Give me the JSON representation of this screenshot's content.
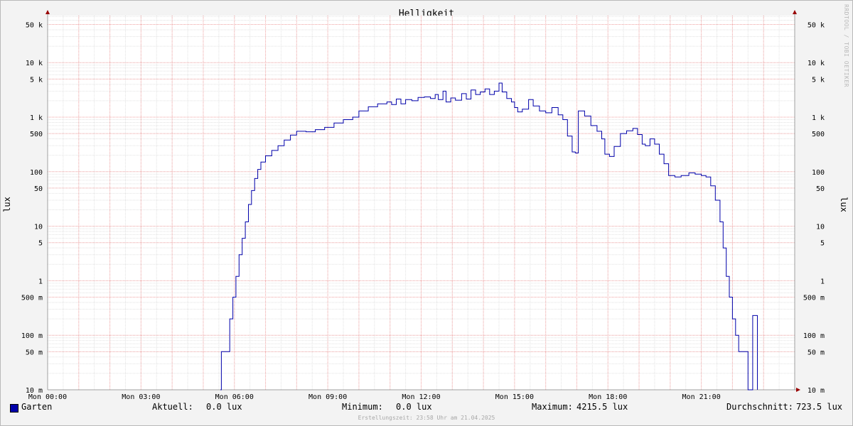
{
  "chart_data": {
    "type": "line",
    "title": "Helligkeit",
    "ylabel": "lux",
    "y_scale": "log",
    "ylim": [
      0.01,
      80000
    ],
    "grid": true,
    "y_ticks": [
      {
        "value": 50000,
        "label": "50 k"
      },
      {
        "value": 10000,
        "label": "10 k"
      },
      {
        "value": 5000,
        "label": "5 k"
      },
      {
        "value": 1000,
        "label": "1 k"
      },
      {
        "value": 500,
        "label": "500"
      },
      {
        "value": 100,
        "label": "100"
      },
      {
        "value": 50,
        "label": "50"
      },
      {
        "value": 10,
        "label": "10"
      },
      {
        "value": 5,
        "label": "5"
      },
      {
        "value": 1,
        "label": "1"
      },
      {
        "value": 0.5,
        "label": "500 m"
      },
      {
        "value": 0.1,
        "label": "100 m"
      },
      {
        "value": 0.05,
        "label": "50 m"
      },
      {
        "value": 0.01,
        "label": "10 m"
      }
    ],
    "x_ticks": [
      {
        "hour": 0,
        "label": "Mon 00:00"
      },
      {
        "hour": 3,
        "label": "Mon 03:00"
      },
      {
        "hour": 6,
        "label": "Mon 06:00"
      },
      {
        "hour": 9,
        "label": "Mon 09:00"
      },
      {
        "hour": 12,
        "label": "Mon 12:00"
      },
      {
        "hour": 15,
        "label": "Mon 15:00"
      },
      {
        "hour": 18,
        "label": "Mon 18:00"
      },
      {
        "hour": 21,
        "label": "Mon 21:00"
      }
    ],
    "xlim_hours": [
      0,
      24
    ],
    "series": [
      {
        "name": "Garten",
        "color": "#0000aa",
        "points": [
          [
            5.55,
            0.0
          ],
          [
            5.58,
            0.05
          ],
          [
            5.8,
            0.05
          ],
          [
            5.85,
            0.2
          ],
          [
            5.95,
            0.5
          ],
          [
            6.05,
            1.2
          ],
          [
            6.15,
            3
          ],
          [
            6.25,
            6
          ],
          [
            6.35,
            12
          ],
          [
            6.45,
            25
          ],
          [
            6.55,
            45
          ],
          [
            6.65,
            75
          ],
          [
            6.75,
            110
          ],
          [
            6.85,
            150
          ],
          [
            7.0,
            195
          ],
          [
            7.2,
            245
          ],
          [
            7.4,
            300
          ],
          [
            7.6,
            380
          ],
          [
            7.8,
            470
          ],
          [
            8.0,
            550
          ],
          [
            8.3,
            540
          ],
          [
            8.6,
            590
          ],
          [
            8.9,
            650
          ],
          [
            9.2,
            780
          ],
          [
            9.5,
            900
          ],
          [
            9.8,
            1000
          ],
          [
            10.0,
            1300
          ],
          [
            10.3,
            1550
          ],
          [
            10.6,
            1750
          ],
          [
            10.9,
            1900
          ],
          [
            11.05,
            1700
          ],
          [
            11.2,
            2150
          ],
          [
            11.35,
            1750
          ],
          [
            11.5,
            2100
          ],
          [
            11.7,
            2000
          ],
          [
            11.9,
            2300
          ],
          [
            12.1,
            2350
          ],
          [
            12.3,
            2200
          ],
          [
            12.45,
            2600
          ],
          [
            12.55,
            2100
          ],
          [
            12.7,
            3000
          ],
          [
            12.8,
            1900
          ],
          [
            12.95,
            2250
          ],
          [
            13.1,
            2050
          ],
          [
            13.3,
            2700
          ],
          [
            13.45,
            2150
          ],
          [
            13.6,
            3150
          ],
          [
            13.75,
            2600
          ],
          [
            13.9,
            2900
          ],
          [
            14.05,
            3300
          ],
          [
            14.2,
            2600
          ],
          [
            14.35,
            3000
          ],
          [
            14.5,
            4215.5
          ],
          [
            14.6,
            2900
          ],
          [
            14.75,
            2200
          ],
          [
            14.9,
            1900
          ],
          [
            15.0,
            1500
          ],
          [
            15.1,
            1250
          ],
          [
            15.25,
            1400
          ],
          [
            15.45,
            2100
          ],
          [
            15.6,
            1600
          ],
          [
            15.8,
            1300
          ],
          [
            16.0,
            1200
          ],
          [
            16.2,
            1500
          ],
          [
            16.4,
            1100
          ],
          [
            16.55,
            900
          ],
          [
            16.7,
            450
          ],
          [
            16.85,
            230
          ],
          [
            16.95,
            220
          ],
          [
            17.05,
            1300
          ],
          [
            17.25,
            1050
          ],
          [
            17.45,
            700
          ],
          [
            17.65,
            550
          ],
          [
            17.8,
            400
          ],
          [
            17.9,
            210
          ],
          [
            18.05,
            190
          ],
          [
            18.2,
            290
          ],
          [
            18.4,
            500
          ],
          [
            18.6,
            560
          ],
          [
            18.8,
            620
          ],
          [
            18.95,
            480
          ],
          [
            19.1,
            320
          ],
          [
            19.2,
            300
          ],
          [
            19.35,
            400
          ],
          [
            19.5,
            320
          ],
          [
            19.65,
            210
          ],
          [
            19.8,
            140
          ],
          [
            19.95,
            85
          ],
          [
            20.15,
            80
          ],
          [
            20.35,
            85
          ],
          [
            20.6,
            95
          ],
          [
            20.8,
            90
          ],
          [
            21.0,
            85
          ],
          [
            21.15,
            80
          ],
          [
            21.3,
            55
          ],
          [
            21.45,
            30
          ],
          [
            21.6,
            12
          ],
          [
            21.7,
            4
          ],
          [
            21.8,
            1.2
          ],
          [
            21.9,
            0.5
          ],
          [
            22.0,
            0.2
          ],
          [
            22.1,
            0.1
          ],
          [
            22.2,
            0.05
          ],
          [
            22.35,
            0.05
          ],
          [
            22.45,
            0.05
          ],
          [
            22.5,
            0.0
          ],
          [
            22.55,
            0.0
          ],
          [
            22.65,
            0.23
          ],
          [
            22.75,
            0.23
          ],
          [
            22.8,
            0.0
          ]
        ]
      }
    ]
  },
  "legend": {
    "series_name": "Garten",
    "current_label": "Aktuell:",
    "current_value": "0.0 lux",
    "min_label": "Minimum:",
    "min_value": "0.0 lux",
    "max_label": "Maximum:",
    "max_value": "4215.5 lux",
    "avg_label": "Durchschnitt:",
    "avg_value": "723.5 lux"
  },
  "footer": "Erstellungszeit: 23:58 Uhr am 21.04.2025",
  "watermark": "RRDTOOL / TOBI OETIKER"
}
